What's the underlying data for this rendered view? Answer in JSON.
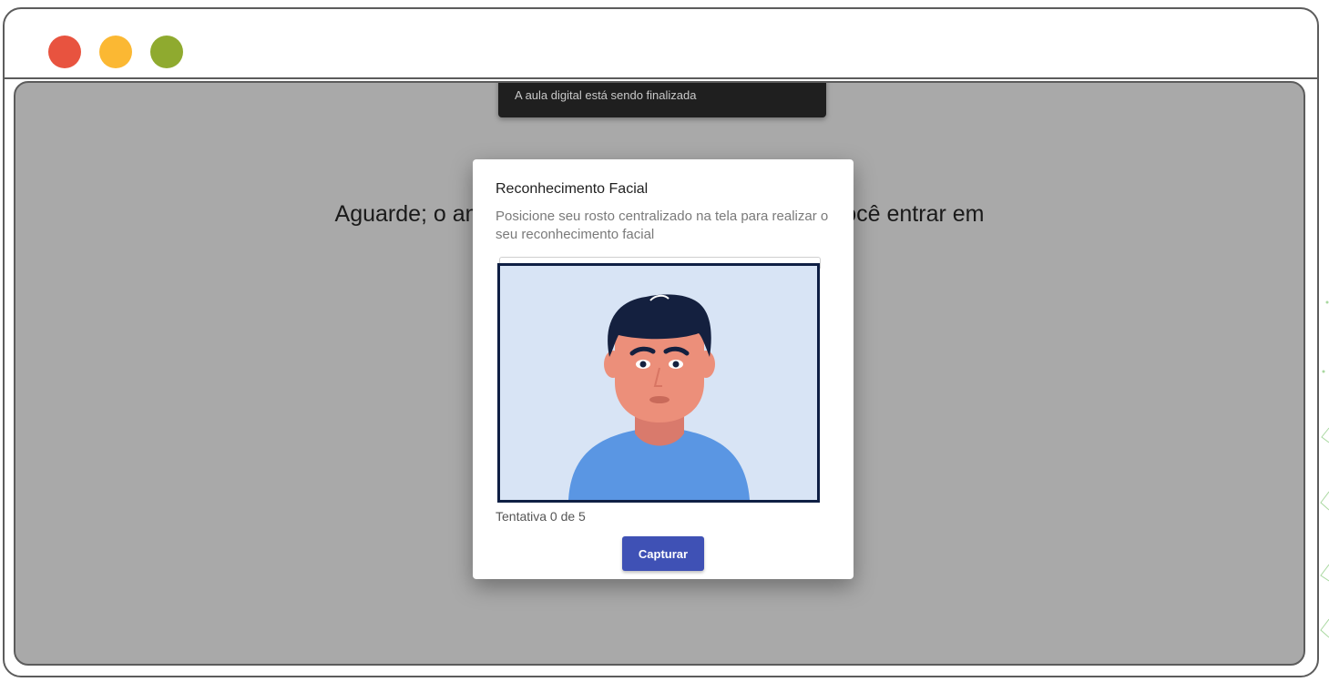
{
  "window": {
    "traffic_lights": {
      "close_color": "#e8533f",
      "minimize_color": "#fbb833",
      "maximize_color": "#8faa2f"
    }
  },
  "page": {
    "background_color": "#a9a9a9",
    "background_message": "Aguarde; o ambiente está sendo preparado para você entrar em"
  },
  "toast": {
    "text": "A aula digital está sendo finalizada"
  },
  "modal": {
    "title": "Reconhecimento Facial",
    "subtitle": "Posicione seu rosto centralizado na tela para realizar o seu reconhecimento facial",
    "attempts_text": "Tentativa 0 de 5",
    "capture_label": "Capturar",
    "capture_color": "#3f51b5"
  },
  "camera": {
    "icon": "person-avatar-icon",
    "background_color": "#d8e4f5",
    "border_color": "#0f1f44"
  }
}
